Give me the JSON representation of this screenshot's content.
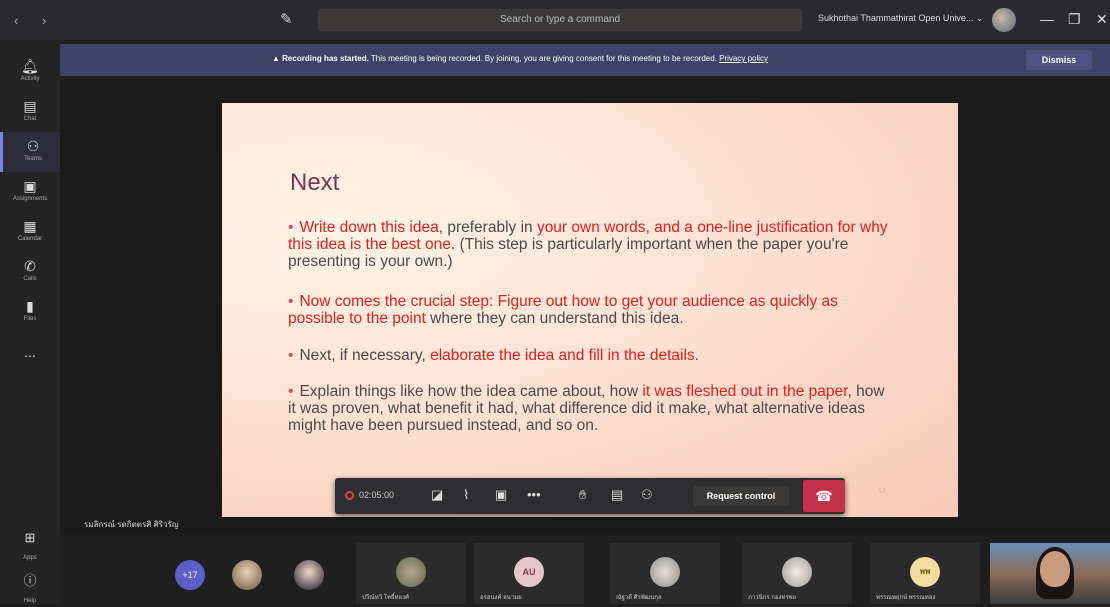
{
  "titlebar": {
    "search_placeholder": "Search or type a command",
    "org_name": "Sukhothai Thammathirat Open Unive... ⌄"
  },
  "rail": {
    "items": [
      {
        "label": "Activity",
        "icon": "bell-icon"
      },
      {
        "label": "Chat",
        "icon": "chat-icon"
      },
      {
        "label": "Teams",
        "icon": "teams-icon"
      },
      {
        "label": "Assignments",
        "icon": "assignments-icon"
      },
      {
        "label": "Calendar",
        "icon": "calendar-icon"
      },
      {
        "label": "Calls",
        "icon": "phone-icon"
      },
      {
        "label": "Files",
        "icon": "file-icon"
      }
    ],
    "more_label": "...",
    "apps_label": "Apps",
    "help_label": "Help"
  },
  "banner": {
    "bold_text": "Recording has started.",
    "text": " This meeting is being recorded. By joining, you are giving consent for this meeting to be recorded. ",
    "link_text": "Privacy policy",
    "dismiss_label": "Dismiss"
  },
  "slide": {
    "title": "Next",
    "bullet1": {
      "r1": "Write down this idea",
      "t1": ", preferably in ",
      "r2": "your own words, and a one-line justification for why this idea is the best one",
      "t2": ". (This step is particularly important when the paper you're presenting is your own.)"
    },
    "bullet2": {
      "r1": "Now comes the crucial step: Figure out how to get your audience as quickly as possible to the point",
      "t1": " where they can understand this idea."
    },
    "bullet3": {
      "t1": "Next, if necessary, ",
      "r1": "elaborate the idea and fill in the details",
      "t2": "."
    },
    "bullet4": {
      "t1": "Explain things like how the idea came about, how ",
      "r1": "it was fleshed out in the paper",
      "t2": ", how it was proven, what benefit it had, what difference did it make, what alternative ideas might have been pursued instead, and so on."
    },
    "page_number": "13"
  },
  "callbar": {
    "rec_time": "02:05:00",
    "request_control_label": "Request control"
  },
  "presenter_name": "รมลิกรณ์ รดกิตตรศิ ศิริวรัญ",
  "participants": {
    "overflow_count": "+17",
    "tiles": [
      {
        "initials": "",
        "name": "ปวีณ์ทวี โพธิ์ทองศ์"
      },
      {
        "initials": "AU",
        "name": "อรอนงค์ อนามย"
      },
      {
        "initials": "",
        "name": "ณัฐวดี ศิรพัฒนกุล"
      },
      {
        "initials": "",
        "name": "ภาวนิกร กองทรพย"
      },
      {
        "initials": "พพ",
        "name": "พรรณพฤกษ์ พรรณทอง"
      }
    ]
  }
}
